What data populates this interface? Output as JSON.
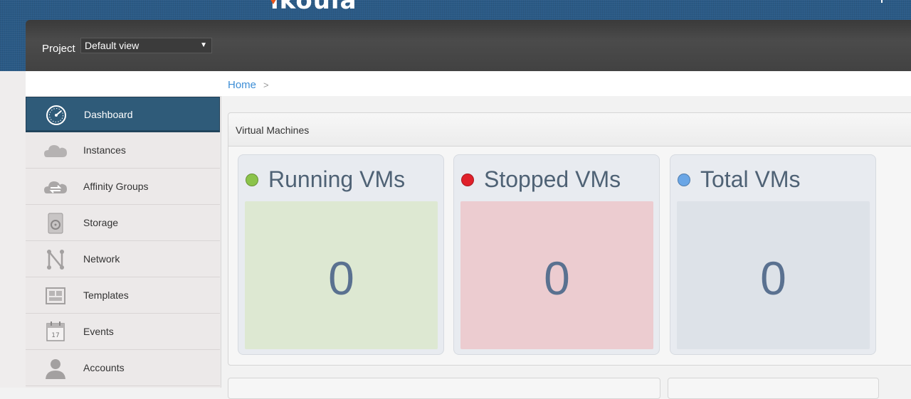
{
  "header": {
    "logo_text": "ikoula",
    "accent": "#e8541a"
  },
  "project": {
    "label": "Project",
    "selected": "Default view"
  },
  "sidebar": {
    "items": [
      {
        "label": "Dashboard",
        "icon": "dashboard-icon",
        "active": true
      },
      {
        "label": "Instances",
        "icon": "cloud-icon"
      },
      {
        "label": "Affinity Groups",
        "icon": "cloud-sync-icon"
      },
      {
        "label": "Storage",
        "icon": "disk-icon"
      },
      {
        "label": "Network",
        "icon": "network-icon"
      },
      {
        "label": "Templates",
        "icon": "templates-icon"
      },
      {
        "label": "Events",
        "icon": "calendar-icon"
      },
      {
        "label": "Accounts",
        "icon": "user-icon"
      }
    ],
    "active_color": "#2f5b79",
    "events_icon_day": "17"
  },
  "breadcrumb": {
    "home": "Home",
    "separator": ">"
  },
  "vm_panel": {
    "title": "Virtual Machines",
    "cards": [
      {
        "title": "Running VMs",
        "count": "0",
        "dot_color": "#8bc34a",
        "box_color": "#dde8d2"
      },
      {
        "title": "Stopped VMs",
        "count": "0",
        "dot_color": "#e0202a",
        "box_color": "#ecccd0"
      },
      {
        "title": "Total VMs",
        "count": "0",
        "dot_color": "#6aa6e6",
        "box_color": "#dde2e8"
      }
    ]
  }
}
